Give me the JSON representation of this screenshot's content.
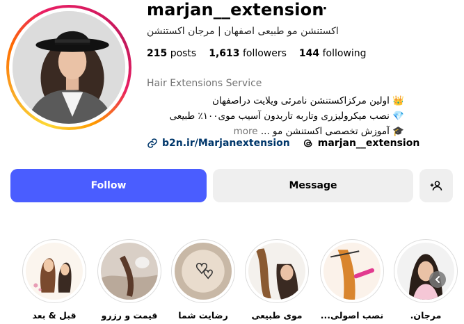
{
  "profile": {
    "username": "marjan__extension",
    "more_icon": "⋯",
    "full_name": "اکستنشن مو طبیعی اصفهان | مرجان اکستنشن",
    "stats": {
      "posts_count": "215",
      "posts_label": "posts",
      "followers_count": "1,613",
      "followers_label": "followers",
      "following_count": "144",
      "following_label": "following"
    },
    "category": "Hair Extensions Service",
    "bio": {
      "line1": "👑 اولین مرکزاکستنشن نامرئی ویلایت دراصفهان",
      "line2": "💎 نصب میکرولیزری وتاربه تاربدون آسیب موی۱۰۰٪ طبیعی",
      "line3": "🎓 آموزش تخصصی اکستنشن مو ...",
      "more": "more"
    },
    "link": "b2n.ir/Marjanextension",
    "threads": "marjan__extension"
  },
  "actions": {
    "follow": "Follow",
    "message": "Message",
    "add_user_icon": "add-user-icon"
  },
  "highlights": [
    {
      "label": "قبل & بعد"
    },
    {
      "label": "قیمت و رزرو"
    },
    {
      "label": "رضایت شما"
    },
    {
      "label": "موی طبیعی"
    },
    {
      "label": "نصب اصولی..."
    },
    {
      "label": "مرجان."
    }
  ],
  "colors": {
    "follow_button": "#4a5dff",
    "secondary_button": "#efefef",
    "link": "#00376b",
    "muted_text": "#737373"
  }
}
